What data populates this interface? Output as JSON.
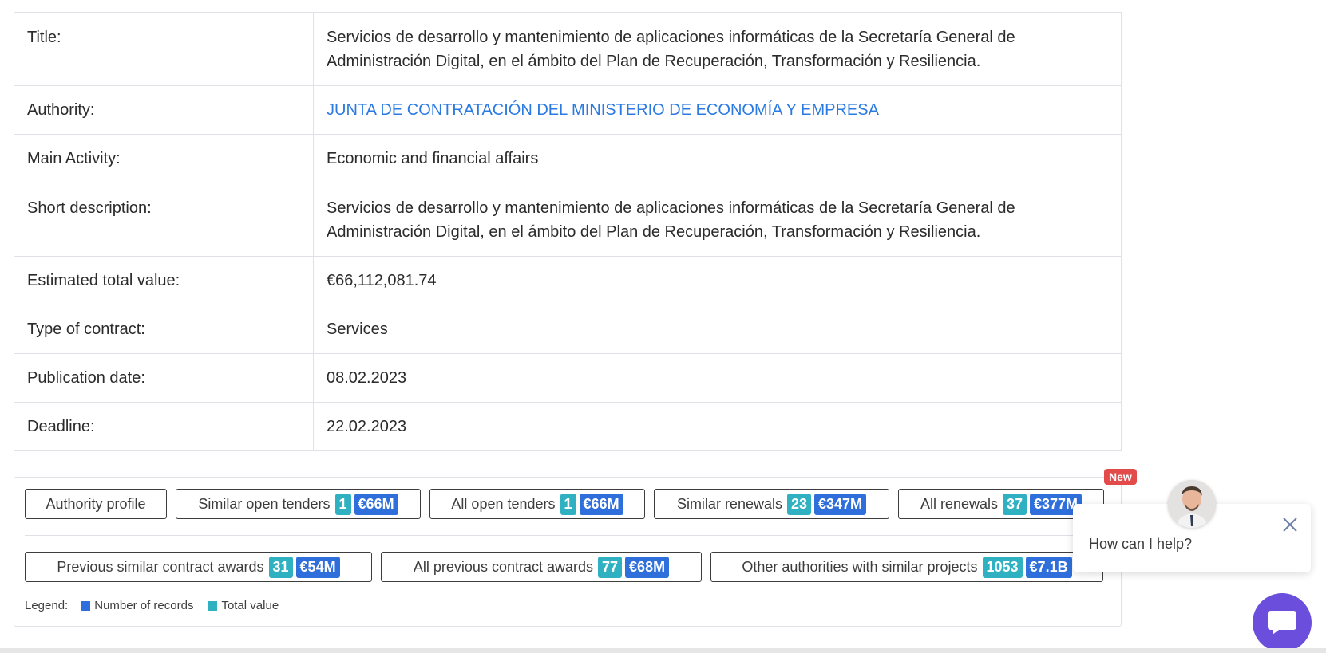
{
  "details": {
    "title_label": "Title:",
    "title_value": "Servicios de desarrollo y mantenimiento de aplicaciones informáticas de la Secretaría General de Administración Digital, en el ámbito del Plan de Recuperación, Transformación y Resiliencia.",
    "authority_label": "Authority:",
    "authority_value": "JUNTA DE CONTRATACIÓN DEL MINISTERIO DE ECONOMÍA Y EMPRESA",
    "main_activity_label": "Main Activity:",
    "main_activity_value": "Economic and financial affairs",
    "short_description_label": "Short description:",
    "short_description_value": "Servicios de desarrollo y mantenimiento de aplicaciones informáticas de la Secretaría General de Administración Digital, en el ámbito del Plan de Recuperación, Transformación y Resiliencia.",
    "estimated_value_label": "Estimated total value:",
    "estimated_value_value": "€66,112,081.74",
    "contract_type_label": "Type of contract:",
    "contract_type_value": "Services",
    "publication_date_label": "Publication date:",
    "publication_date_value": "08.02.2023",
    "deadline_label": "Deadline:",
    "deadline_value": "22.02.2023"
  },
  "buttons": {
    "authority_profile": "Authority profile",
    "similar_open": {
      "label": "Similar open tenders",
      "count": "1",
      "value": "€66M"
    },
    "all_open": {
      "label": "All open tenders",
      "count": "1",
      "value": "€66M"
    },
    "similar_renewals": {
      "label": "Similar renewals",
      "count": "23",
      "value": "€347M"
    },
    "all_renewals": {
      "label": "All renewals",
      "count": "37",
      "value": "€377M"
    },
    "prev_similar_awards": {
      "label": "Previous similar contract awards",
      "count": "31",
      "value": "€54M"
    },
    "all_prev_awards": {
      "label": "All previous contract awards",
      "count": "77",
      "value": "€68M"
    },
    "other_authorities": {
      "label": "Other authorities with similar projects",
      "count": "1053",
      "value": "€7.1B"
    }
  },
  "new_tag": "New",
  "legend": {
    "label": "Legend:",
    "records": "Number of records",
    "total": "Total value"
  },
  "colors": {
    "count_badge": "#2fb1c2",
    "value_badge": "#2f6fdc",
    "link": "#2a7ae2",
    "chat_accent": "#6b4fdc"
  },
  "chat": {
    "prompt": "How can I help?"
  }
}
